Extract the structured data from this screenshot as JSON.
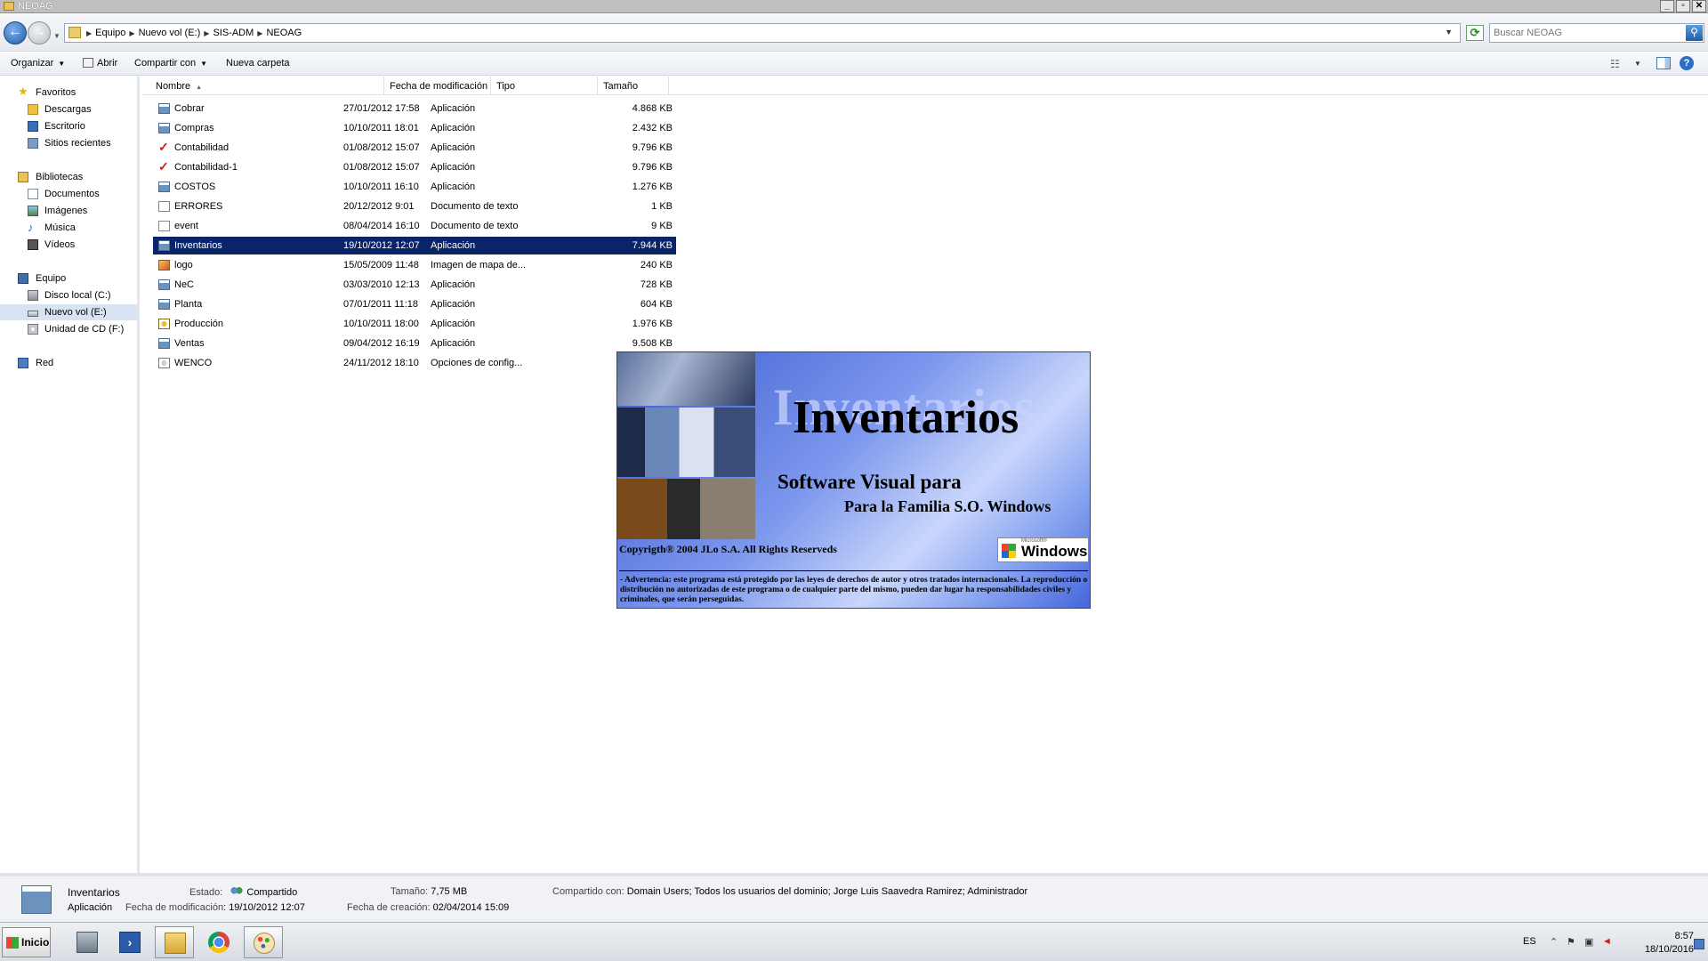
{
  "window": {
    "title": "NEOAG",
    "controls": {
      "minimize": "_",
      "maximize": "▫",
      "close": "✕"
    }
  },
  "address": {
    "breadcrumb": [
      "Equipo",
      "Nuevo vol (E:)",
      "SIS-ADM",
      "NEOAG"
    ],
    "search_placeholder": "Buscar NEOAG"
  },
  "toolbar": {
    "organize": "Organizar",
    "open": "Abrir",
    "share": "Compartir con",
    "new_folder": "Nueva carpeta"
  },
  "nav": {
    "favorites": "Favoritos",
    "downloads": "Descargas",
    "desktop": "Escritorio",
    "recent": "Sitios recientes",
    "libraries": "Bibliotecas",
    "documents": "Documentos",
    "images": "Imágenes",
    "music": "Música",
    "videos": "Vídeos",
    "computer": "Equipo",
    "drive_c": "Disco local (C:)",
    "drive_e": "Nuevo vol (E:)",
    "drive_f": "Unidad de CD (F:)",
    "network": "Red"
  },
  "columns": {
    "name": "Nombre",
    "date": "Fecha de modificación",
    "type": "Tipo",
    "size": "Tamaño"
  },
  "files": [
    {
      "name": "Cobrar",
      "date": "27/01/2012 17:58",
      "type": "Aplicación",
      "size": "4.868 KB",
      "icon": "app-icon"
    },
    {
      "name": "Compras",
      "date": "10/10/2011 18:01",
      "type": "Aplicación",
      "size": "2.432 KB",
      "icon": "app-icon"
    },
    {
      "name": "Contabilidad",
      "date": "01/08/2012 15:07",
      "type": "Aplicación",
      "size": "9.796 KB",
      "icon": "checkmark-icon"
    },
    {
      "name": "Contabilidad-1",
      "date": "01/08/2012 15:07",
      "type": "Aplicación",
      "size": "9.796 KB",
      "icon": "checkmark-icon"
    },
    {
      "name": "COSTOS",
      "date": "10/10/2011 16:10",
      "type": "Aplicación",
      "size": "1.276 KB",
      "icon": "app-icon"
    },
    {
      "name": "ERRORES",
      "date": "20/12/2012 9:01",
      "type": "Documento de texto",
      "size": "1 KB",
      "icon": "text-file-icon"
    },
    {
      "name": "event",
      "date": "08/04/2014 16:10",
      "type": "Documento de texto",
      "size": "9 KB",
      "icon": "text-file-icon"
    },
    {
      "name": "Inventarios",
      "date": "19/10/2012 12:07",
      "type": "Aplicación",
      "size": "7.944 KB",
      "icon": "app-icon",
      "selected": true
    },
    {
      "name": "logo",
      "date": "15/05/2009 11:48",
      "type": "Imagen de mapa de...",
      "size": "240 KB",
      "icon": "bitmap-icon"
    },
    {
      "name": "NeC",
      "date": "03/03/2010 12:13",
      "type": "Aplicación",
      "size": "728 KB",
      "icon": "app-icon"
    },
    {
      "name": "Planta",
      "date": "07/01/2011 11:18",
      "type": "Aplicación",
      "size": "604 KB",
      "icon": "app-icon"
    },
    {
      "name": "Producción",
      "date": "10/10/2011 18:00",
      "type": "Aplicación",
      "size": "1.976 KB",
      "icon": "production-app-icon"
    },
    {
      "name": "Ventas",
      "date": "09/04/2012 16:19",
      "type": "Aplicación",
      "size": "9.508 KB",
      "icon": "app-icon"
    },
    {
      "name": "WENCO",
      "date": "24/11/2012 18:10",
      "type": "Opciones de config...",
      "size": "",
      "icon": "config-file-icon"
    }
  ],
  "splash": {
    "title": "Inventarios",
    "subtitle1": "Software Visual para",
    "subtitle2": "Para la Familia S.O. Windows",
    "copyright": "Copyrigth® 2004 JLo  S.A.  All Rights Reserveds",
    "windows_logo_small": "Microsoft®",
    "windows_logo": "Windows",
    "warning": "- Advertencia: este programa está protegido por las leyes de derechos de autor y otros tratados internacionales. La reproducción o distribución no autorizadas de este programa o de cualquier parte del mismo, pueden dar lugar ha responsabilidades civiles y criminales, que serán perseguidas."
  },
  "details": {
    "name": "Inventarios",
    "kind": "Aplicación",
    "state_label": "Estado:",
    "state_value": "Compartido",
    "modified_label": "Fecha de modificación:",
    "modified_value": "19/10/2012 12:07",
    "size_label": "Tamaño:",
    "size_value": "7,75 MB",
    "created_label": "Fecha de creación:",
    "created_value": "02/04/2014 15:09",
    "shared_label": "Compartido con:",
    "shared_value": "Domain Users; Todos los usuarios del dominio; Jorge Luis Saavedra Ramirez; Administrador"
  },
  "taskbar": {
    "start": "Inicio",
    "apps": [
      "server-manager-icon",
      "powershell-icon",
      "file-explorer-icon",
      "chrome-icon",
      "paint-icon"
    ],
    "language": "ES",
    "time": "8:57",
    "date": "18/10/2016"
  },
  "colors": {
    "selection": "#0a246a",
    "splash_blue": "#4466dc"
  }
}
